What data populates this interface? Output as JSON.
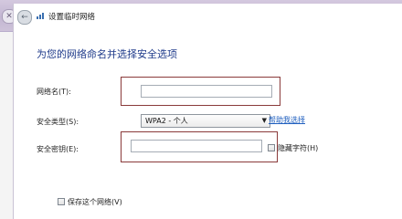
{
  "window": {
    "title": "设置临时网络"
  },
  "heading": "为您的网络命名并选择安全选项",
  "network_name": {
    "label": "网络名(T):",
    "value": ""
  },
  "security_type": {
    "label": "安全类型(S):",
    "selected": "WPA2 - 个人",
    "help_link": "帮助我选择"
  },
  "security_key": {
    "label": "安全密钥(E):",
    "value": "",
    "hide_chars_label": "隐藏字符(H)"
  },
  "save_network": {
    "label": "保存这个网络(V)"
  },
  "colors": {
    "heading": "#1e3a8a",
    "link": "#1f5fbf",
    "highlight": "#8a3a3a"
  }
}
